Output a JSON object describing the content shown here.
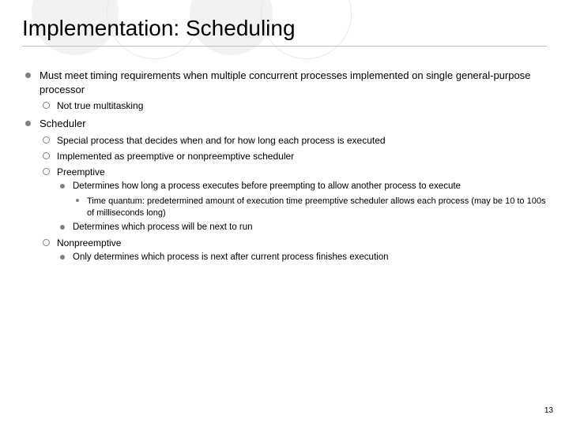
{
  "title": "Implementation: Scheduling",
  "bullets": {
    "b1": "Must meet timing requirements when multiple concurrent processes implemented on single general-purpose processor",
    "b1_1": "Not true multitasking",
    "b2": "Scheduler",
    "b2_1": "Special process that decides when and for how long each process is executed",
    "b2_2": "Implemented as preemptive or nonpreemptive scheduler",
    "b2_3": "Preemptive",
    "b2_3_1": "Determines how long a process executes before preempting to allow another process to execute",
    "b2_3_1_1": "Time quantum: predetermined amount of execution time preemptive scheduler allows each process (may be 10 to 100s of milliseconds long)",
    "b2_3_2": "Determines which process will be next to run",
    "b2_4": "Nonpreemptive",
    "b2_4_1": "Only determines which process is next after current process finishes execution"
  },
  "page_number": "13"
}
